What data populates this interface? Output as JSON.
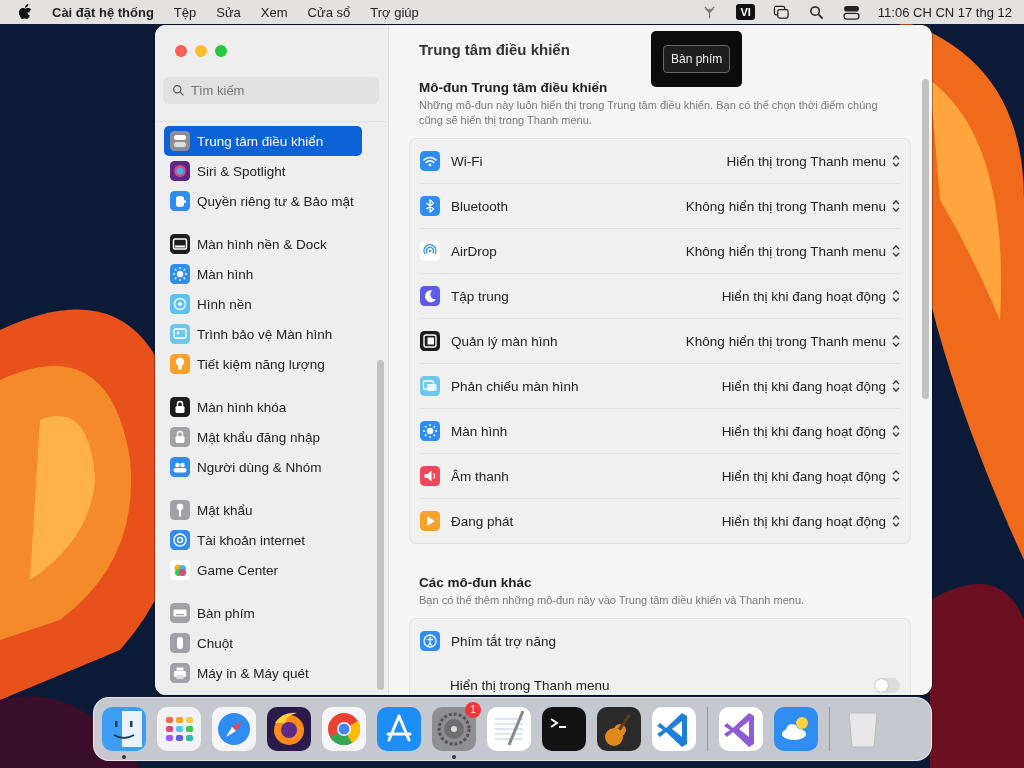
{
  "menu_bar": {
    "app_name": "Cài đặt hệ thống",
    "menus": [
      "Tệp",
      "Sửa",
      "Xem",
      "Cửa sổ",
      "Trợ giúp"
    ],
    "input_source": "VI",
    "clock": "11:06 CH CN 17 thg 12"
  },
  "sidebar": {
    "search": {
      "placeholder": "Tìm kiếm"
    },
    "groups": [
      [
        {
          "label": "Trung tâm điều khiển",
          "kind": "toggles",
          "color": "#8e8e93",
          "selected": true
        },
        {
          "label": "Siri & Spotlight",
          "kind": "siri",
          "color": "#5b2a86",
          "selected": false
        },
        {
          "label": "Quyền riêng tư & Bảo mật",
          "kind": "hand",
          "color": "#2f8cf0",
          "selected": false
        }
      ],
      [
        {
          "label": "Màn hình nền & Dock",
          "kind": "dock",
          "color": "#1c1c1e",
          "selected": false
        },
        {
          "label": "Màn hình",
          "kind": "sun",
          "color": "#2f8cf0",
          "selected": false
        },
        {
          "label": "Hình nền",
          "kind": "flower",
          "color": "#5ac2f0",
          "selected": false
        },
        {
          "label": "Trình bảo vệ Màn hình",
          "kind": "screen",
          "color": "#6cc8ee",
          "selected": false
        },
        {
          "label": "Tiết kiệm năng lượng",
          "kind": "bulb",
          "color": "#f7a12b",
          "selected": false
        }
      ],
      [
        {
          "label": "Màn hình khóa",
          "kind": "lock",
          "color": "#1c1c1e",
          "selected": false
        },
        {
          "label": "Mật khẩu đăng nhập",
          "kind": "lock",
          "color": "#a1a1a6",
          "selected": false
        },
        {
          "label": "Người dùng & Nhóm",
          "kind": "people",
          "color": "#2f8cf0",
          "selected": false
        }
      ],
      [
        {
          "label": "Mật khẩu",
          "kind": "key",
          "color": "#a1a1a6",
          "selected": false
        },
        {
          "label": "Tài khoản internet",
          "kind": "at",
          "color": "#2f8cf0",
          "selected": false
        },
        {
          "label": "Game Center",
          "kind": "bubbles",
          "color": "#ffffff",
          "selected": false
        }
      ],
      [
        {
          "label": "Bàn phím",
          "kind": "keyboard",
          "color": "#a1a1a6",
          "selected": false
        },
        {
          "label": "Chuột",
          "kind": "mouse",
          "color": "#a1a1a6",
          "selected": false
        },
        {
          "label": "Máy in & Máy quét",
          "kind": "printer",
          "color": "#a1a1a6",
          "selected": false
        }
      ]
    ]
  },
  "main": {
    "title": "Trung tâm điều khiển",
    "tooltip": "Bàn phím",
    "sections": [
      {
        "heading": "Mô-đun Trung tâm điều khiển",
        "description": "Những mô-đun này luôn hiển thị trong Trung tâm điều khiển. Bạn có thể chọn thời điểm chúng cũng sẽ hiển thị trong Thanh menu.",
        "rows": [
          {
            "name": "Wi-Fi",
            "kind": "wifi",
            "color": "#2f8cf0",
            "value": "Hiển thị trong Thanh menu"
          },
          {
            "name": "Bluetooth",
            "kind": "bluetooth",
            "color": "#2f8cf0",
            "value": "Không hiển thị trong Thanh menu"
          },
          {
            "name": "AirDrop",
            "kind": "airdrop",
            "color": "#ffffff",
            "value": "Không hiển thị trong Thanh menu"
          },
          {
            "name": "Tập trung",
            "kind": "moon",
            "color": "#5e5ce6",
            "value": "Hiển thị khi đang hoạt động"
          },
          {
            "name": "Quản lý màn hình",
            "kind": "stage",
            "color": "#1c1c1e",
            "value": "Không hiển thị trong Thanh menu"
          },
          {
            "name": "Phản chiếu màn hình",
            "kind": "mirror",
            "color": "#6cc8ee",
            "value": "Hiển thị khi đang hoạt động"
          },
          {
            "name": "Màn hình",
            "kind": "sun",
            "color": "#2f8cf0",
            "value": "Hiển thị khi đang hoạt động"
          },
          {
            "name": "Âm thanh",
            "kind": "speaker",
            "color": "#f0455a",
            "value": "Hiển thị khi đang hoạt động"
          },
          {
            "name": "Đang phát",
            "kind": "play",
            "color": "#f7a12b",
            "value": "Hiển thị khi đang hoạt động"
          }
        ]
      },
      {
        "heading": "Các mô-đun khác",
        "description": "Bạn có thể thêm những mô-đun này vào Trung tâm điều khiển và Thanh menu.",
        "rows": [
          {
            "name": "Phím tắt trợ năng",
            "kind": "access",
            "color": "#2f8cf0",
            "option": {
              "label": "Hiển thị trong Thanh menu",
              "on": false
            }
          }
        ]
      }
    ]
  },
  "dock": {
    "items": [
      {
        "kind": "face",
        "running": true
      },
      {
        "kind": "grid",
        "running": false
      },
      {
        "kind": "compass",
        "running": false
      },
      {
        "kind": "fox",
        "running": false
      },
      {
        "kind": "ring",
        "running": false
      },
      {
        "kind": "tools",
        "running": false
      },
      {
        "kind": "gear",
        "running": true,
        "badge": "1"
      },
      {
        "kind": "notepad",
        "running": false
      },
      {
        "kind": "terminal",
        "running": false
      },
      {
        "kind": "guitar",
        "running": false
      },
      {
        "kind": "code",
        "running": false
      },
      {
        "kind": "separator"
      },
      {
        "kind": "ribbon",
        "running": false
      },
      {
        "kind": "weather",
        "running": false
      },
      {
        "kind": "separator"
      },
      {
        "kind": "trash",
        "running": false
      }
    ]
  }
}
